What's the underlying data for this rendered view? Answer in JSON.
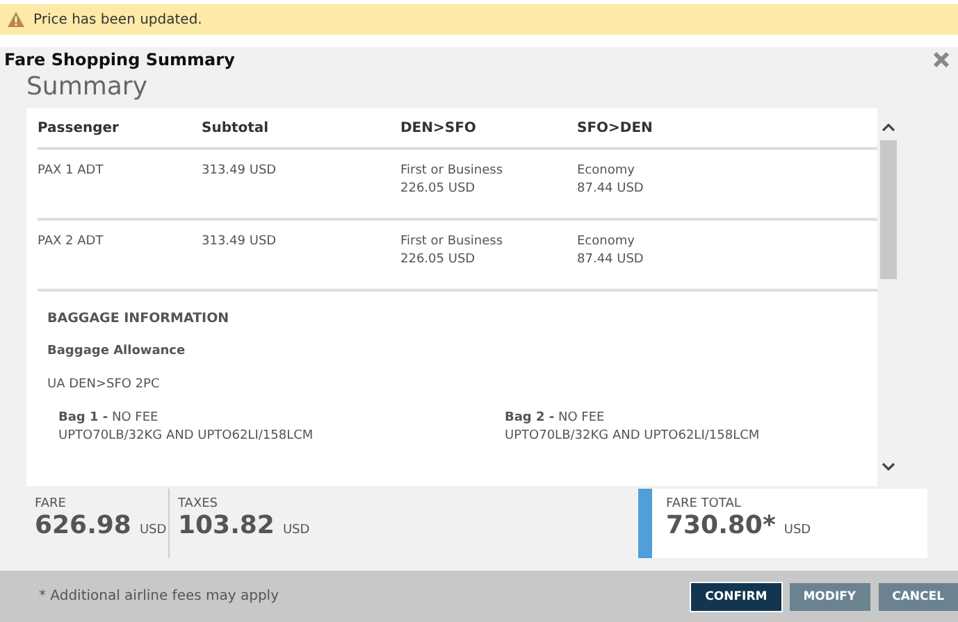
{
  "alert": {
    "message": "Price has been updated."
  },
  "dialog": {
    "title": "Fare Shopping Summary",
    "heading": "Summary"
  },
  "table": {
    "columns": [
      "Passenger",
      "Subtotal",
      "DEN>SFO",
      "SFO>DEN"
    ],
    "rows": [
      {
        "passenger": "PAX 1 ADT",
        "subtotal": "313.49 USD",
        "legs": [
          {
            "cabin": "First or Business",
            "price": "226.05 USD"
          },
          {
            "cabin": "Economy",
            "price": "87.44 USD"
          }
        ]
      },
      {
        "passenger": "PAX 2 ADT",
        "subtotal": "313.49 USD",
        "legs": [
          {
            "cabin": "First or Business",
            "price": "226.05 USD"
          },
          {
            "cabin": "Economy",
            "price": "87.44 USD"
          }
        ]
      }
    ]
  },
  "baggage": {
    "title": "BAGGAGE INFORMATION",
    "subtitle": "Baggage Allowance",
    "segment": "UA DEN>SFO 2PC",
    "bags": [
      {
        "label": "Bag 1 -",
        "fee": "NO FEE",
        "limits": "UPTO70LB/32KG AND UPTO62LI/158LCM"
      },
      {
        "label": "Bag 2 -",
        "fee": "NO FEE",
        "limits": "UPTO70LB/32KG AND UPTO62LI/158LCM"
      }
    ]
  },
  "totals": [
    {
      "label": "FARE",
      "amount": "626.98",
      "currency": "USD",
      "kind": "plain"
    },
    {
      "label": "TAXES",
      "amount": "103.82",
      "currency": "USD",
      "kind": "plain"
    },
    {
      "label": "FARE TOTAL",
      "amount": "730.80*",
      "currency": "USD",
      "kind": "total"
    }
  ],
  "footer": {
    "note": "* Additional airline fees may apply",
    "buttons": [
      {
        "label": "CONFIRM",
        "kind": "primary"
      },
      {
        "label": "MODIFY",
        "kind": "secondary"
      },
      {
        "label": "CANCEL",
        "kind": "secondary"
      }
    ]
  }
}
